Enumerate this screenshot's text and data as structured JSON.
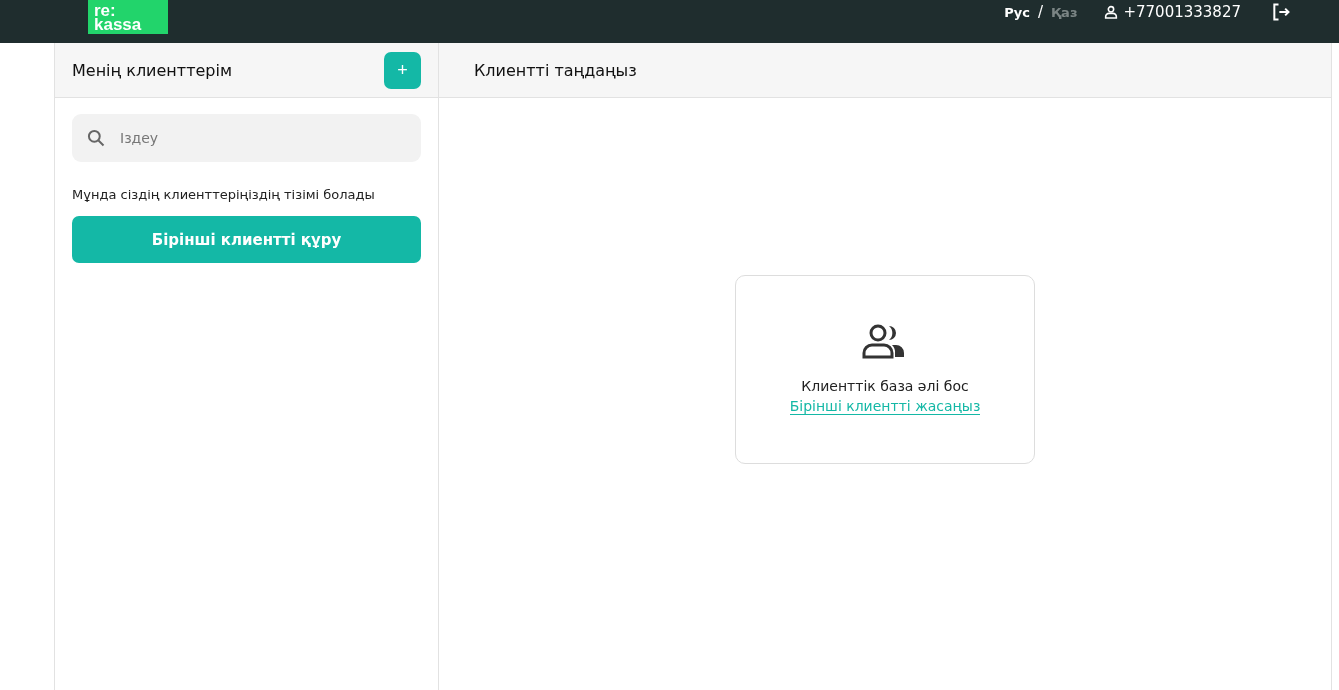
{
  "header": {
    "logo": [
      "re:",
      "kassa"
    ],
    "languages": [
      {
        "label": "Рус",
        "selected": true
      },
      {
        "label": "Қаз",
        "selected": false
      }
    ],
    "separator": "/",
    "phone": "+77001333827"
  },
  "sidebar": {
    "title": "Менің клиенттерім",
    "add_button": "+",
    "search": {
      "placeholder": "Іздеу"
    },
    "hint": "Мұнда сіздің клиенттеріңіздің тізімі болады",
    "create_button": "Бірінші клиентті құру"
  },
  "main": {
    "title": "Клиентті таңдаңыз",
    "empty": {
      "message": "Клиенттік база әлі бос",
      "link": "Бірінші клиентті жасаңыз"
    }
  }
}
